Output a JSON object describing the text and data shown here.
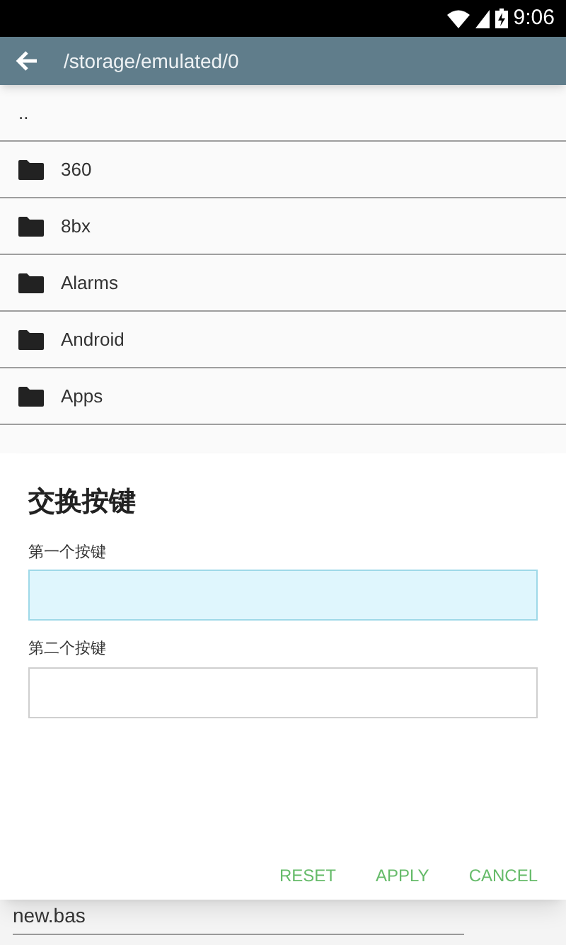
{
  "status_bar": {
    "time": "9:06"
  },
  "app_bar": {
    "path": "/storage/emulated/0"
  },
  "files": [
    {
      "name": "..",
      "kind": "parent"
    },
    {
      "name": "360",
      "kind": "folder"
    },
    {
      "name": "8bx",
      "kind": "folder"
    },
    {
      "name": "Alarms",
      "kind": "folder"
    },
    {
      "name": "Android",
      "kind": "folder"
    },
    {
      "name": "Apps",
      "kind": "folder"
    }
  ],
  "dialog": {
    "title": "交换按键",
    "fields": [
      {
        "label": "第一个按键",
        "focused": true
      },
      {
        "label": "第二个按键",
        "focused": false
      }
    ],
    "buttons": [
      "RESET",
      "APPLY",
      "CANCEL"
    ]
  },
  "filename_field": {
    "value": "new.bas"
  }
}
